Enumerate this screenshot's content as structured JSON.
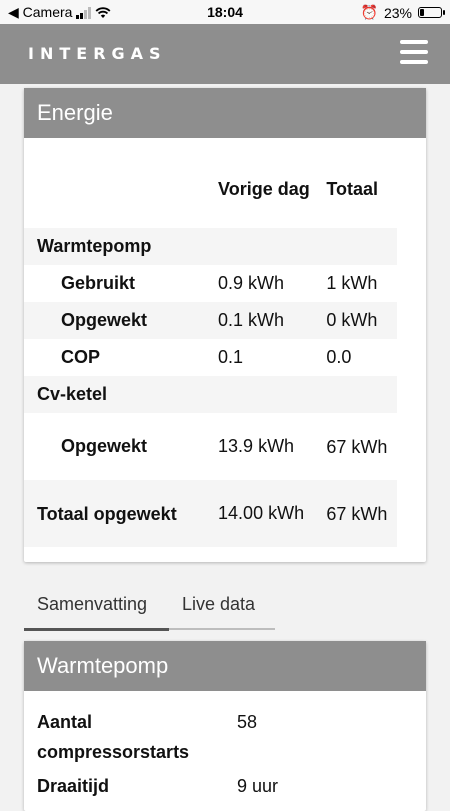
{
  "statusbar": {
    "back_label": "◀ Camera",
    "time": "18:04",
    "alarm_icon": "⏰",
    "battery": "23%",
    "battery_level": 0.23
  },
  "header": {
    "logo": "INTERGAS",
    "menu_icon": "hamburger-menu-icon"
  },
  "energie": {
    "title": "Energie",
    "col_prev": "Vorige dag",
    "col_total": "Totaal",
    "section_wp": "Warmtepomp",
    "rows_wp": [
      {
        "label": "Gebruikt",
        "prev": "0.9 kWh",
        "total": "1 kWh"
      },
      {
        "label": "Opgewekt",
        "prev": "0.1 kWh",
        "total": "0 kWh"
      },
      {
        "label": "COP",
        "prev": "0.1",
        "total": "0.0"
      }
    ],
    "section_cv": "Cv-ketel",
    "rows_cv": [
      {
        "label": "Opgewekt",
        "prev": "13.9 kWh",
        "total": "67 kWh"
      }
    ],
    "total_row": {
      "label": "Totaal opgewekt",
      "prev": "14.00 kWh",
      "total": "67 kWh"
    }
  },
  "tabs": [
    "Samenvatting",
    "Live data"
  ],
  "warmtepomp": {
    "title": "Warmtepomp",
    "rows": [
      {
        "label": "Aantal compressorstarts",
        "value": "58"
      },
      {
        "label": "Draaitijd",
        "value": "9 uur"
      }
    ]
  }
}
